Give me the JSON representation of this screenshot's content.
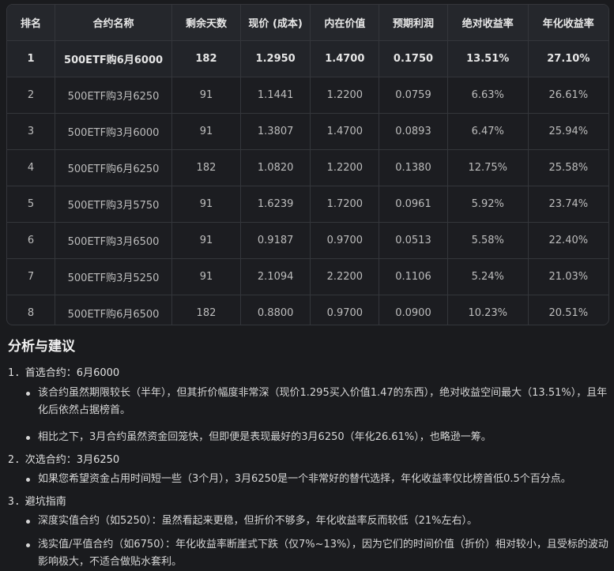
{
  "table": {
    "headers": [
      "排名",
      "合约名称",
      "剩余天数",
      "现价 (成本)",
      "内在价值",
      "预期利润",
      "绝对收益率",
      "年化收益率"
    ],
    "rows": [
      [
        "1",
        "500ETF购6月6000",
        "182",
        "1.2950",
        "1.4700",
        "0.1750",
        "13.51%",
        "27.10%"
      ],
      [
        "2",
        "500ETF购3月6250",
        "91",
        "1.1441",
        "1.2200",
        "0.0759",
        "6.63%",
        "26.61%"
      ],
      [
        "3",
        "500ETF购3月6000",
        "91",
        "1.3807",
        "1.4700",
        "0.0893",
        "6.47%",
        "25.94%"
      ],
      [
        "4",
        "500ETF购6月6250",
        "182",
        "1.0820",
        "1.2200",
        "0.1380",
        "12.75%",
        "25.58%"
      ],
      [
        "5",
        "500ETF购3月5750",
        "91",
        "1.6239",
        "1.7200",
        "0.0961",
        "5.92%",
        "23.74%"
      ],
      [
        "6",
        "500ETF购3月6500",
        "91",
        "0.9187",
        "0.9700",
        "0.0513",
        "5.58%",
        "22.40%"
      ],
      [
        "7",
        "500ETF购3月5250",
        "91",
        "2.1094",
        "2.2200",
        "0.1106",
        "5.24%",
        "21.03%"
      ],
      [
        "8",
        "500ETF购6月6500",
        "182",
        "0.8800",
        "0.9700",
        "0.0900",
        "10.23%",
        "20.51%"
      ]
    ]
  },
  "analysis": {
    "title": "分析与建议",
    "sections": [
      {
        "num": "1.",
        "heading": "首选合约：6月6000",
        "bullets": [
          "该合约虽然期限较长（半年），但其折价幅度非常深（现价1.295买入价值1.47的东西），绝对收益空间最大（13.51%），且年化后依然占据榜首。",
          "相比之下，3月合约虽然资金回笼快，但即便是表现最好的3月6250（年化26.61%），也略逊一筹。"
        ]
      },
      {
        "num": "2.",
        "heading": "次选合约：3月6250",
        "bullets": [
          "如果您希望资金占用时间短一些（3个月），3月6250是一个非常好的替代选择，年化收益率仅比榜首低0.5个百分点。"
        ]
      },
      {
        "num": "3.",
        "heading": "避坑指南",
        "bullets": [
          "深度实值合约（如5250）：虽然看起来更稳，但折价不够多，年化收益率反而较低（21%左右）。",
          "浅实值/平值合约（如6750）：年化收益率断崖式下跌（仅7%~13%），因为它们的时间价值（折价）相对较小，且受标的波动影响极大，不适合做贴水套利。"
        ]
      }
    ]
  }
}
